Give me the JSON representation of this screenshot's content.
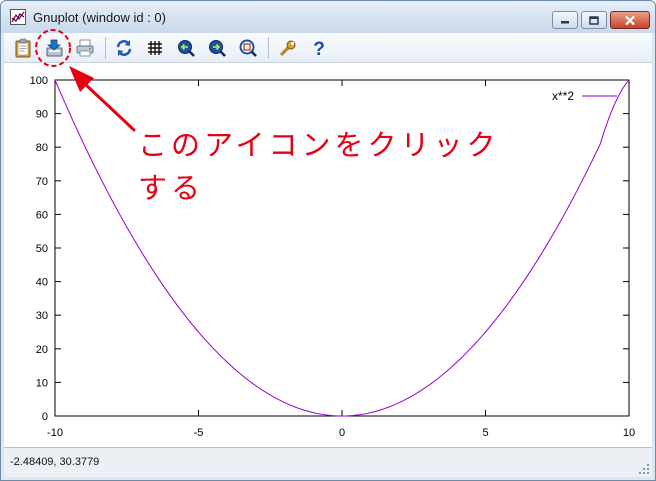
{
  "window": {
    "title": "Gnuplot (window id : 0)"
  },
  "toolbar": {
    "buttons": [
      {
        "name": "copy-to-clipboard-icon"
      },
      {
        "name": "export-icon"
      },
      {
        "name": "print-icon"
      },
      {
        "name": "replot-icon"
      },
      {
        "name": "grid-icon"
      },
      {
        "name": "zoom-previous-icon"
      },
      {
        "name": "zoom-next-icon"
      },
      {
        "name": "autoscale-icon"
      },
      {
        "name": "options-icon"
      },
      {
        "name": "help-icon"
      }
    ]
  },
  "colors": {
    "series": "#9400d3",
    "annotation": "#e60012"
  },
  "annotation": {
    "line1": "このアイコンをクリック",
    "line2": "する"
  },
  "status": {
    "text": "-2.48409,  30.3779"
  },
  "chart_data": {
    "type": "line",
    "xlim": [
      -10,
      10
    ],
    "ylim": [
      0,
      100
    ],
    "x_ticks": [
      -10,
      -5,
      0,
      5,
      10
    ],
    "y_ticks": [
      0,
      10,
      20,
      30,
      40,
      50,
      60,
      70,
      80,
      90,
      100
    ],
    "grid": false,
    "legend_position": "top-right",
    "series": [
      {
        "name": "x**2",
        "x": [
          -10,
          -9,
          -8,
          -7,
          -6,
          -5,
          -4,
          -3,
          -2,
          -1,
          0,
          1,
          2,
          3,
          4,
          5,
          6,
          7,
          8,
          9,
          10
        ],
        "y": [
          100,
          81,
          64,
          49,
          36,
          25,
          16,
          9,
          4,
          1,
          0,
          1,
          4,
          9,
          16,
          25,
          36,
          49,
          64,
          81,
          100
        ]
      }
    ]
  }
}
